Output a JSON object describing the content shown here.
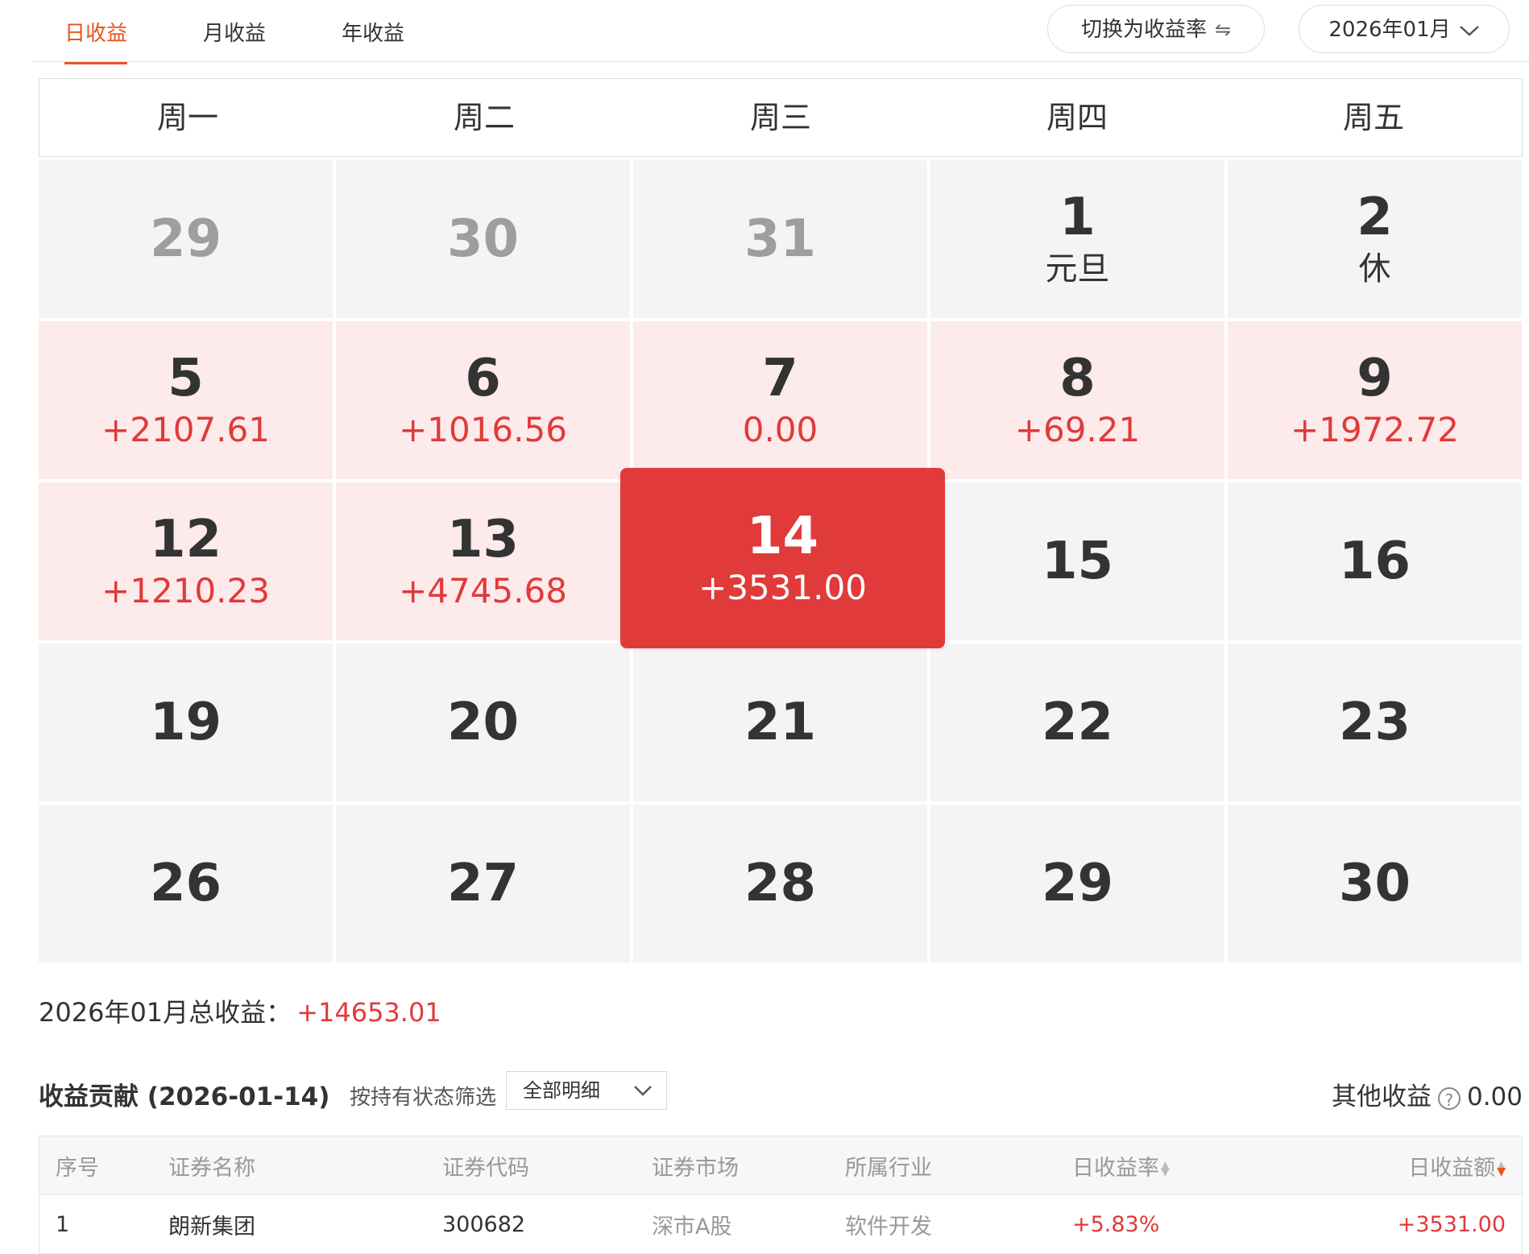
{
  "tabs": [
    {
      "label": "日收益",
      "active": true
    },
    {
      "label": "月收益",
      "active": false
    },
    {
      "label": "年收益",
      "active": false
    }
  ],
  "toggle_button": {
    "label": "切换为收益率",
    "icon": "swap-icon"
  },
  "month_select": {
    "value": "2026年01月",
    "icon": "chevron-down-icon"
  },
  "calendar": {
    "weekdays": [
      "周一",
      "周二",
      "周三",
      "周四",
      "周五"
    ],
    "cells": [
      {
        "day": "29",
        "sub": "",
        "pnl": "",
        "state": "other"
      },
      {
        "day": "30",
        "sub": "",
        "pnl": "",
        "state": "other"
      },
      {
        "day": "31",
        "sub": "",
        "pnl": "",
        "state": "other"
      },
      {
        "day": "1",
        "sub": "元旦",
        "pnl": "",
        "state": "normal"
      },
      {
        "day": "2",
        "sub": "休",
        "pnl": "",
        "state": "normal"
      },
      {
        "day": "5",
        "sub": "",
        "pnl": "+2107.61",
        "state": "pos"
      },
      {
        "day": "6",
        "sub": "",
        "pnl": "+1016.56",
        "state": "pos"
      },
      {
        "day": "7",
        "sub": "",
        "pnl": "0.00",
        "state": "pos"
      },
      {
        "day": "8",
        "sub": "",
        "pnl": "+69.21",
        "state": "pos"
      },
      {
        "day": "9",
        "sub": "",
        "pnl": "+1972.72",
        "state": "pos"
      },
      {
        "day": "12",
        "sub": "",
        "pnl": "+1210.23",
        "state": "pos"
      },
      {
        "day": "13",
        "sub": "",
        "pnl": "+4745.68",
        "state": "pos"
      },
      {
        "day": "14",
        "sub": "",
        "pnl": "+3531.00",
        "state": "selected"
      },
      {
        "day": "15",
        "sub": "",
        "pnl": "",
        "state": "normal"
      },
      {
        "day": "16",
        "sub": "",
        "pnl": "",
        "state": "normal"
      },
      {
        "day": "19",
        "sub": "",
        "pnl": "",
        "state": "normal"
      },
      {
        "day": "20",
        "sub": "",
        "pnl": "",
        "state": "normal"
      },
      {
        "day": "21",
        "sub": "",
        "pnl": "",
        "state": "normal"
      },
      {
        "day": "22",
        "sub": "",
        "pnl": "",
        "state": "normal"
      },
      {
        "day": "23",
        "sub": "",
        "pnl": "",
        "state": "normal"
      },
      {
        "day": "26",
        "sub": "",
        "pnl": "",
        "state": "normal"
      },
      {
        "day": "27",
        "sub": "",
        "pnl": "",
        "state": "normal"
      },
      {
        "day": "28",
        "sub": "",
        "pnl": "",
        "state": "normal"
      },
      {
        "day": "29",
        "sub": "",
        "pnl": "",
        "state": "normal"
      },
      {
        "day": "30",
        "sub": "",
        "pnl": "",
        "state": "normal"
      }
    ]
  },
  "summary": {
    "label": "2026年01月总收益：",
    "value": "+14653.01"
  },
  "contribution": {
    "title": "收益贡献 (2026-01-14)",
    "filter_label": "按持有状态筛选",
    "filter_value": "全部明细",
    "other_label": "其他收益",
    "other_value": "0.00"
  },
  "table": {
    "headers": [
      "序号",
      "证券名称",
      "证券代码",
      "证券市场",
      "所属行业",
      "日收益率",
      "日收益额"
    ],
    "rows": [
      {
        "index": "1",
        "name": "朗新集团",
        "code": "300682",
        "market": "深市A股",
        "industry": "软件开发",
        "rate": "+5.83%",
        "amount": "+3531.00"
      }
    ]
  },
  "colors": {
    "accent": "#e8541c",
    "profit": "#e03a3a",
    "selected_bg": "#e03a3a",
    "pos_bg": "#fdeaea"
  }
}
